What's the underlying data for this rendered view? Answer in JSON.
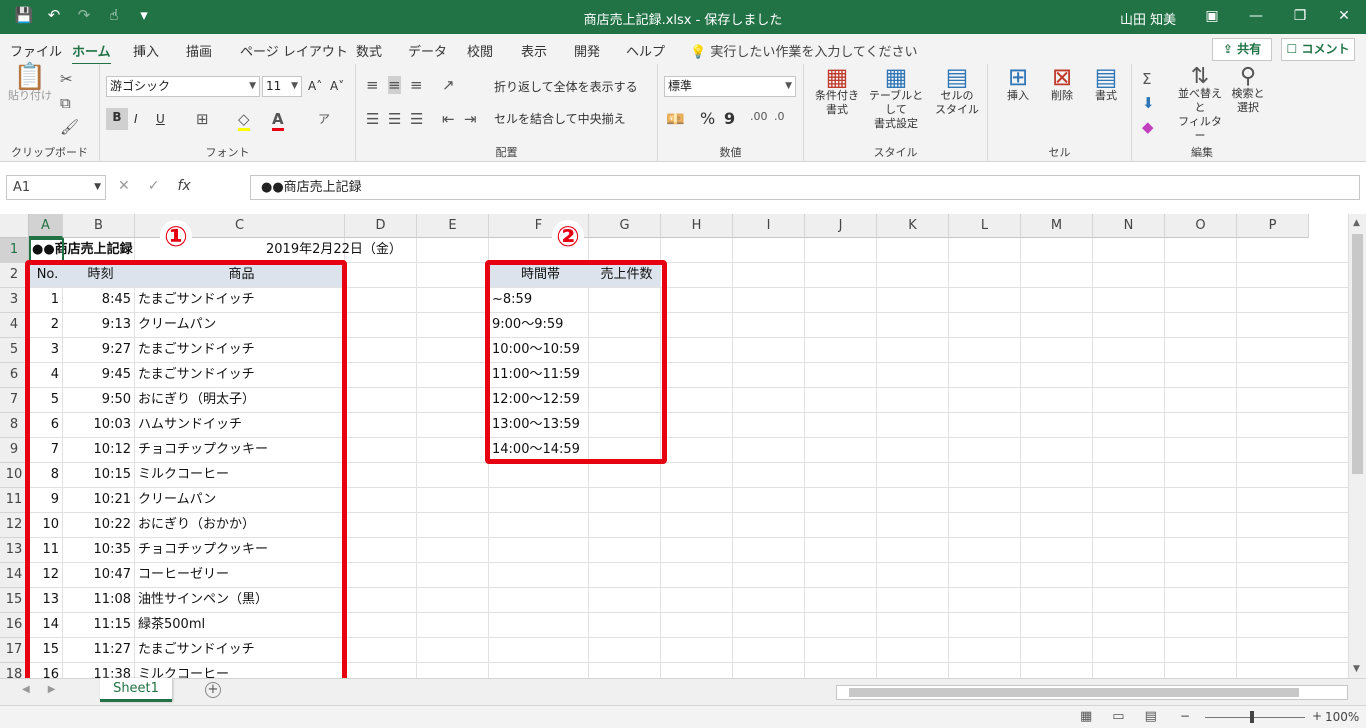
{
  "window": {
    "title": "商店売上記録.xlsx  -  保存しました",
    "user": "山田 知美"
  },
  "qat": {
    "save_icon": "💾",
    "undo_icon": "↶",
    "redo_icon": "↷",
    "touch_icon": "☝",
    "more_icon": "▾"
  },
  "winbtns": {
    "ribbon": "▣",
    "min": "—",
    "max": "❐",
    "close": "✕"
  },
  "tabs": [
    {
      "label": "ファイル"
    },
    {
      "label": "ホーム"
    },
    {
      "label": "挿入"
    },
    {
      "label": "描画"
    },
    {
      "label": "ページ レイアウト"
    },
    {
      "label": "数式"
    },
    {
      "label": "データ"
    },
    {
      "label": "校閲"
    },
    {
      "label": "表示"
    },
    {
      "label": "開発"
    },
    {
      "label": "ヘルプ"
    }
  ],
  "tell_me": "💡 実行したい作業を入力してください",
  "share_label": "⇪ 共有",
  "comment_label": "☐ コメント",
  "ribbon": {
    "clipboard": {
      "label": "クリップボード",
      "paste": "貼り付け"
    },
    "font": {
      "label": "フォント",
      "name": "游ゴシック",
      "size": "11",
      "bold": "B",
      "italic": "I",
      "underline": "U",
      "grow": "A˄",
      "shrink": "A˅"
    },
    "alignment": {
      "label": "配置",
      "wrap": "折り返して全体を表示する",
      "merge": "セルを結合して中央揃え"
    },
    "number": {
      "label": "数値",
      "format": "標準",
      "percent": "%",
      "comma": "9"
    },
    "styles": {
      "label": "スタイル",
      "conditional": "条件付き\n書式",
      "table": "テーブルとして\n書式設定",
      "cellstyle": "セルの\nスタイル"
    },
    "cells": {
      "label": "セル",
      "insert": "挿入",
      "delete": "削除",
      "format": "書式"
    },
    "editing": {
      "label": "編集",
      "sortfilter": "並べ替えと\nフィルター",
      "findselect": "検索と\n選択"
    }
  },
  "formula_bar": {
    "name_box": "A1",
    "cancel": "✕",
    "enter": "✓",
    "fx": "fx",
    "content": "●●商店売上記録"
  },
  "columns": [
    "A",
    "B",
    "C",
    "D",
    "E",
    "F",
    "G",
    "H",
    "I",
    "J",
    "K",
    "L",
    "M",
    "N",
    "O",
    "P"
  ],
  "rows": [
    "1",
    "2",
    "3",
    "4",
    "5",
    "6",
    "7",
    "8",
    "9",
    "10",
    "11",
    "12",
    "13",
    "14",
    "15",
    "16",
    "17",
    "18"
  ],
  "sheet": {
    "title": "●●商店売上記録",
    "date": "2019年2月22日（金）",
    "headers": {
      "no": "No.",
      "time": "時刻",
      "item": "商品"
    },
    "records": [
      {
        "no": "1",
        "time": "8:45",
        "item": "たまごサンドイッチ"
      },
      {
        "no": "2",
        "time": "9:13",
        "item": "クリームパン"
      },
      {
        "no": "3",
        "time": "9:27",
        "item": "たまごサンドイッチ"
      },
      {
        "no": "4",
        "time": "9:45",
        "item": "たまごサンドイッチ"
      },
      {
        "no": "5",
        "time": "9:50",
        "item": "おにぎり（明太子）"
      },
      {
        "no": "6",
        "time": "10:03",
        "item": "ハムサンドイッチ"
      },
      {
        "no": "7",
        "time": "10:12",
        "item": "チョコチップクッキー"
      },
      {
        "no": "8",
        "time": "10:15",
        "item": "ミルクコーヒー"
      },
      {
        "no": "9",
        "time": "10:21",
        "item": "クリームパン"
      },
      {
        "no": "10",
        "time": "10:22",
        "item": "おにぎり（おかか）"
      },
      {
        "no": "11",
        "time": "10:35",
        "item": "チョコチップクッキー"
      },
      {
        "no": "12",
        "time": "10:47",
        "item": "コーヒーゼリー"
      },
      {
        "no": "13",
        "time": "11:08",
        "item": "油性サインペン（黒）"
      },
      {
        "no": "14",
        "time": "11:15",
        "item": "緑茶500ml"
      },
      {
        "no": "15",
        "time": "11:27",
        "item": "たまごサンドイッチ"
      },
      {
        "no": "16",
        "time": "11:38",
        "item": "ミルクコーヒー"
      }
    ],
    "summary_headers": {
      "band": "時間帯",
      "count": "売上件数"
    },
    "bands": [
      "~8:59",
      "9:00～9:59",
      "10:00～10:59",
      "11:00～11:59",
      "12:00～12:59",
      "13:00～13:59",
      "14:00～14:59"
    ]
  },
  "markers": {
    "m1": "①",
    "m2": "②"
  },
  "sheet_tab": "Sheet1",
  "add_sheet": "+",
  "status": {
    "zoom_minus": "−",
    "zoom_plus": "+",
    "zoom": "100%"
  },
  "colors": {
    "accent": "#217346",
    "highlight": "#e60012",
    "header_fill": "#dce3ec"
  }
}
